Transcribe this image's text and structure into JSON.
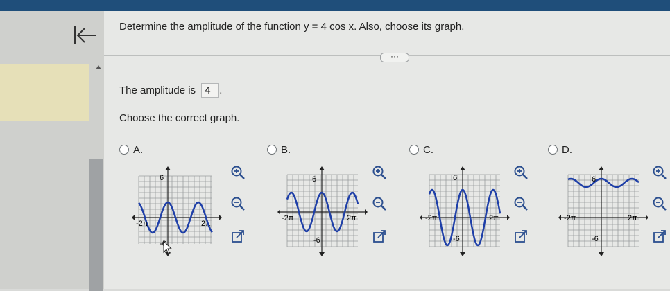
{
  "question": {
    "prefix": "Determine the amplitude of the function ",
    "function": "y = 4 cos x",
    "suffix": ". Also, choose its graph."
  },
  "ellipsis_label": "···",
  "amplitude": {
    "label": "The amplitude is",
    "value": "4",
    "suffix": "."
  },
  "choose_label": "Choose the correct graph.",
  "options": [
    {
      "letter": "A.",
      "y_top": "6",
      "y_bottom": "-6",
      "x_left": "-2π",
      "x_right": "2π"
    },
    {
      "letter": "B.",
      "y_top": "6",
      "y_bottom": "-6",
      "x_left": "-2π",
      "x_right": "2π"
    },
    {
      "letter": "C.",
      "y_top": "6",
      "y_bottom": "-6",
      "x_left": "-2π",
      "x_right": "2π"
    },
    {
      "letter": "D.",
      "y_top": "6",
      "y_bottom": "-6",
      "x_left": "-2π",
      "x_right": "2π"
    }
  ],
  "icons": {
    "back": "back-arrow-icon",
    "zoom_in": "zoom-in-icon",
    "zoom_out": "zoom-out-icon",
    "popout": "external-link-icon"
  },
  "colors": {
    "curve": "#1e3fa8",
    "topbar": "#1f4e7a",
    "highlight": "#e6e0b8"
  }
}
